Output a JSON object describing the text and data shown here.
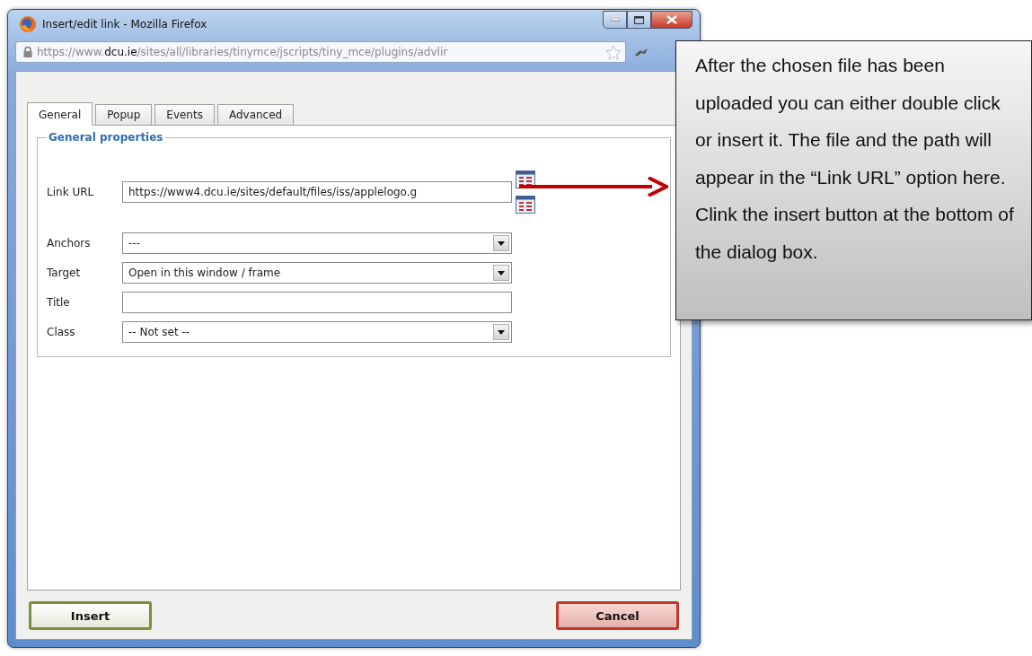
{
  "window": {
    "title": "Insert/edit link - Mozilla Firefox"
  },
  "address_bar": {
    "url": "https://www.**dcu.ie**/sites/all/libraries/tinymce/jscripts/tiny_mce/plugins/advlir"
  },
  "tabs": [
    {
      "label": "General",
      "selected": true
    },
    {
      "label": "Popup",
      "selected": false
    },
    {
      "label": "Events",
      "selected": false
    },
    {
      "label": "Advanced",
      "selected": false
    }
  ],
  "fieldset": {
    "legend": "General properties",
    "fields": [
      {
        "kind": "text",
        "label": "Link URL",
        "value": "https://www4.dcu.ie/sites/default/files/iss/applelogo.g",
        "browse": true
      },
      {
        "kind": "select",
        "label": "Anchors",
        "value": "---"
      },
      {
        "kind": "select",
        "label": "Target",
        "value": "Open in this window / frame"
      },
      {
        "kind": "text",
        "label": "Title"
      },
      {
        "kind": "select",
        "label": "Class",
        "value": "-- Not set --"
      }
    ]
  },
  "buttons": [
    {
      "kind": "confirm",
      "label": "Insert"
    },
    {
      "kind": "cancel",
      "label": "Cancel"
    }
  ],
  "callout": {
    "text": "After the chosen file has been uploaded you can either double click or insert it. The file and the path will appear in the “Link URL” option here. Clink the insert button at the bottom of the dialog box."
  }
}
